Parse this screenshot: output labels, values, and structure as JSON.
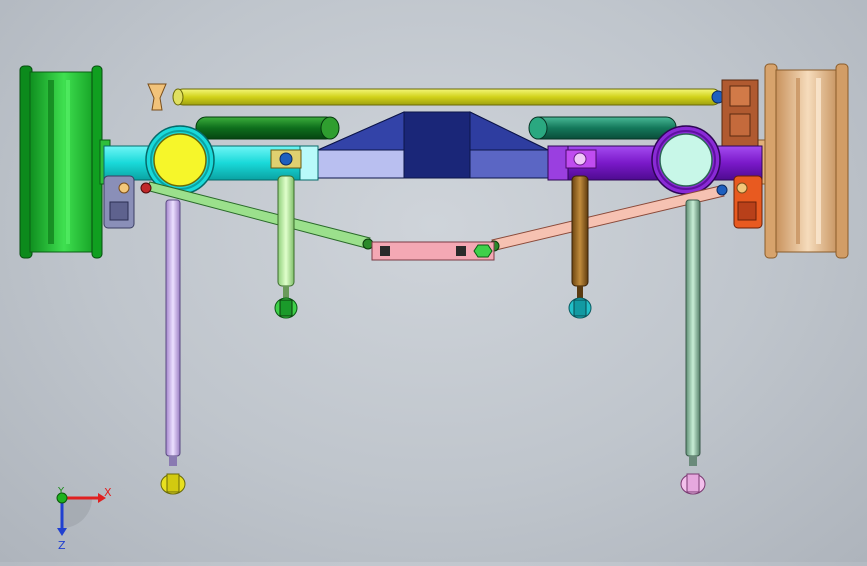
{
  "viewport": {
    "name": "cad-3d-viewport",
    "model": "rear-axle-suspension-assembly"
  },
  "triad": {
    "x_label": "X",
    "y_label": "Y",
    "z_label": "Z",
    "colors": {
      "x": "#e02020",
      "y": "#1fb21f",
      "z": "#2040d0"
    }
  },
  "parts": {
    "left_wheel": {
      "icon": "wheel-rim",
      "color": "#22c33a"
    },
    "right_wheel": {
      "icon": "wheel-rim",
      "color": "#e8c49a"
    },
    "axle_housing": {
      "color_left": "#19d9d9",
      "color_right": "#7a19c9"
    },
    "differential": {
      "color": "#1a2d8a"
    },
    "panhard_rod": {
      "color": "#d6e023"
    },
    "left_link": {
      "color": "#9be08c"
    },
    "right_link": {
      "color": "#f0b8a8"
    },
    "left_shock": {
      "color": "#b8e8a0"
    },
    "right_shock": {
      "color": "#9a6a2a"
    },
    "left_long_rod": {
      "color": "#c8a8e8"
    },
    "right_long_rod": {
      "color": "#8ab8a0"
    }
  }
}
